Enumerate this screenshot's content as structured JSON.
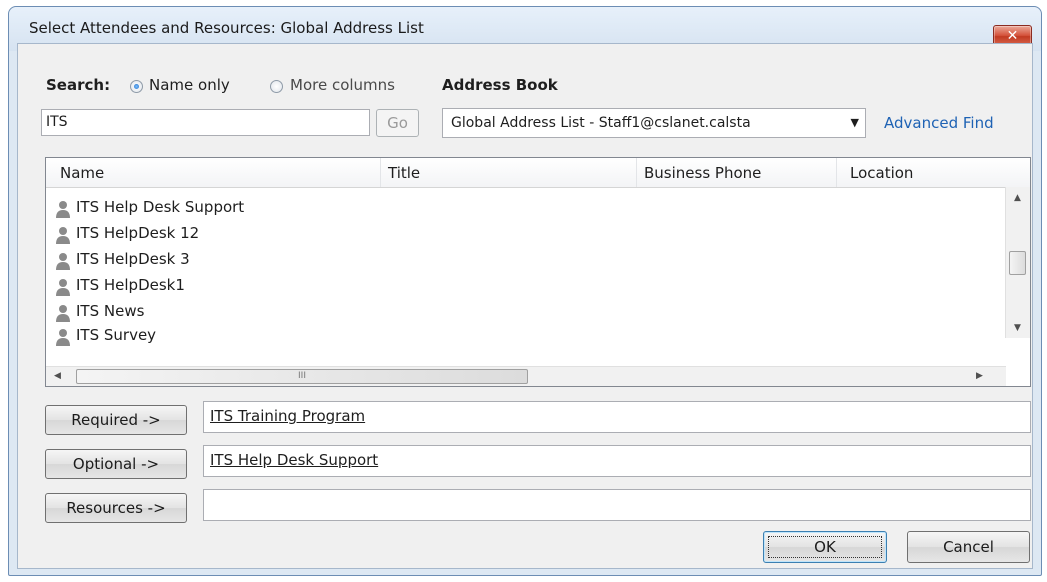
{
  "window": {
    "title": "Select Attendees and Resources: Global Address List",
    "close_label": "✕"
  },
  "search": {
    "label": "Search:",
    "options": [
      "Name only",
      "More columns"
    ],
    "selected": "Name only",
    "value": "ITS",
    "go_label": "Go"
  },
  "address_book": {
    "label": "Address Book",
    "selected": "Global Address List - Staff1@cslanet.calsta",
    "advanced_find_label": "Advanced Find"
  },
  "list": {
    "columns": [
      "Name",
      "Title",
      "Business Phone",
      "Location"
    ],
    "rows": [
      "ITS Help Desk Support",
      "ITS HelpDesk 12",
      "ITS HelpDesk 3",
      "ITS HelpDesk1",
      "ITS News",
      "ITS Survey"
    ],
    "hscroll_grip": "III"
  },
  "recipients": {
    "required_label": "Required ->",
    "required_value": "ITS Training Program",
    "optional_label": "Optional ->",
    "optional_value": "ITS Help Desk Support",
    "resources_label": "Resources ->",
    "resources_value": ""
  },
  "footer": {
    "ok_label": "OK",
    "cancel_label": "Cancel"
  },
  "colors": {
    "accent_link": "#1e62b4",
    "close_button": "#c23a22",
    "frame": "#dde8f3"
  }
}
